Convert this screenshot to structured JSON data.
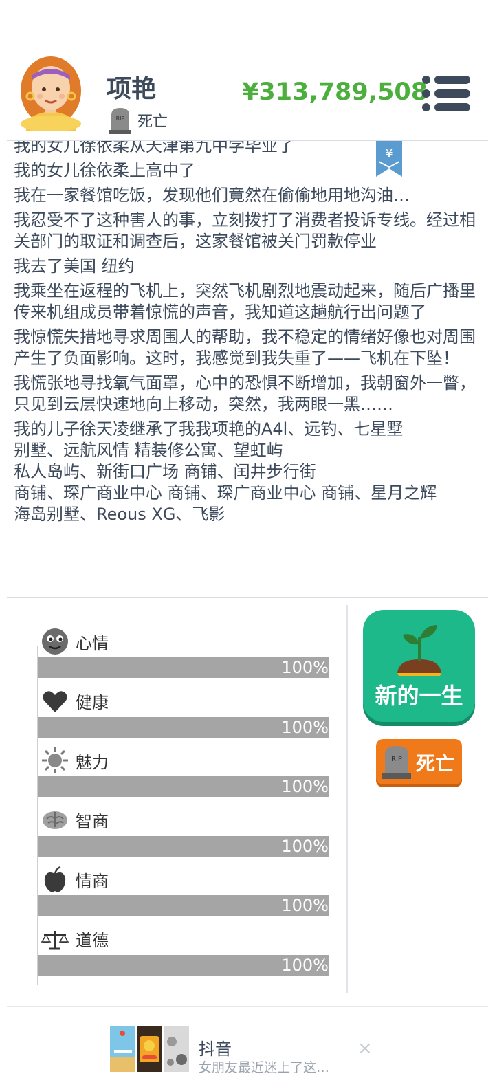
{
  "profile": {
    "name": "项艳",
    "status": "死亡",
    "money": "¥313,789,508"
  },
  "colors": {
    "money": "#4caf3d",
    "text": "#3d4a5c",
    "new_life_button": "#1eb98a",
    "death_button": "#f07a1a",
    "stat_bar": "#a5a5a5"
  },
  "log": [
    "我的女儿徐依柔从天津第九中学毕业了",
    "我的女儿徐依柔上高中了",
    "我在一家餐馆吃饭，发现他们竟然在偷偷地用地沟油…",
    "我忍受不了这种害人的事，立刻拨打了消费者投诉专线。经过相关部门的取证和调查后，这家餐馆被关门罚款停业",
    "我去了美国 纽约",
    "我乘坐在返程的飞机上，突然飞机剧烈地震动起来，随后广播里传来机组成员带着惊慌的声音，我知道这趟航行出问题了",
    "我惊慌失措地寻求周围人的帮助，我不稳定的情绪好像也对周围产生了负面影响。这时，我感觉到我失重了——飞机在下坠！",
    "我慌张地寻找氧气面罩，心中的恐惧不断增加，我朝窗外一瞥，只见到云层快速地向上移动，突然，我两眼一黑……",
    "我的儿子徐天凌继承了我我项艳的A4l、远钓、七星墅",
    "别墅、远航风情 精装修公寓、望虹屿",
    "私人岛屿、新街口广场 商铺、闰井步行街",
    "商铺、琛广商业中心 商铺、琛广商业中心 商铺、星月之辉",
    "海岛别墅、Reous XG、飞影"
  ],
  "stats": [
    {
      "label": "心情",
      "icon": "face-icon",
      "value": "100%",
      "fraction": 1.0
    },
    {
      "label": "健康",
      "icon": "heart-icon",
      "value": "100%",
      "fraction": 1.0
    },
    {
      "label": "魅力",
      "icon": "sun-icon",
      "value": "100%",
      "fraction": 1.0
    },
    {
      "label": "智商",
      "icon": "brain-icon",
      "value": "100%",
      "fraction": 1.0
    },
    {
      "label": "情商",
      "icon": "apple-icon",
      "value": "100%",
      "fraction": 1.0
    },
    {
      "label": "道德",
      "icon": "scale-icon",
      "value": "100%",
      "fraction": 1.0
    }
  ],
  "actions": {
    "new_life": "新的一生",
    "die": "死亡"
  },
  "ad": {
    "title": "抖音",
    "subtitle": "女朋友最近迷上了这…",
    "close": "×"
  }
}
